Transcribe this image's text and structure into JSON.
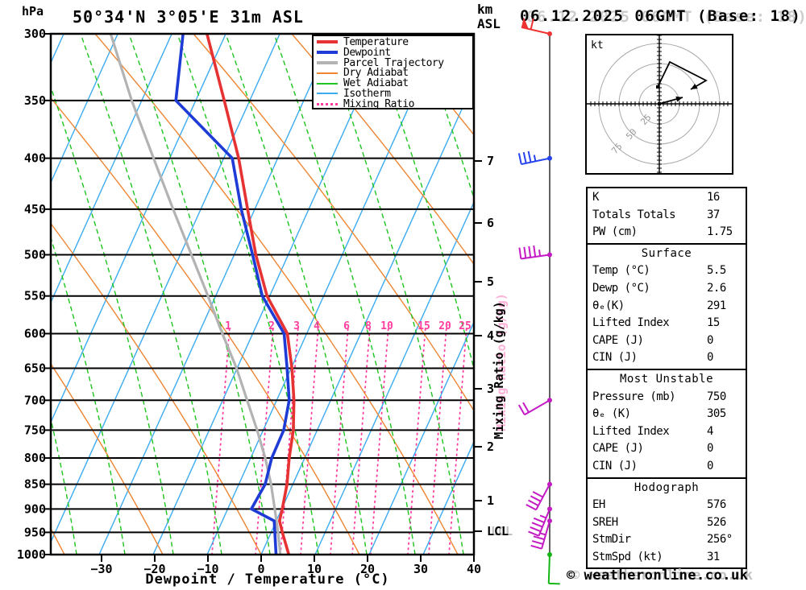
{
  "header": {
    "station_title": "50°34'N 3°05'E 31m ASL",
    "datetime": "06.12.2025 06GMT (Base: 18)",
    "pressure_unit": "hPa",
    "altitude_unit_line1": "km",
    "altitude_unit_line2": "ASL"
  },
  "legend": [
    {
      "label": "Temperature",
      "color": "#e63232",
      "style": "thick"
    },
    {
      "label": "Dewpoint",
      "color": "#1f3bd6",
      "style": "thick"
    },
    {
      "label": "Parcel Trajectory",
      "color": "#b3b3b3",
      "style": "thick"
    },
    {
      "label": "Dry Adiabat",
      "color": "#ef8532",
      "style": "thin"
    },
    {
      "label": "Wet Adiabat",
      "color": "#1fc420",
      "style": "thin"
    },
    {
      "label": "Isotherm",
      "color": "#3cabf0",
      "style": "thin"
    },
    {
      "label": "Mixing Ratio",
      "color": "#ff3d9e",
      "style": "dotted"
    }
  ],
  "axes": {
    "xlabel": "Dewpoint / Temperature (°C)",
    "temp_ticks": [
      -30,
      -20,
      -10,
      0,
      10,
      20,
      30,
      40
    ],
    "pressure_ticks": [
      300,
      350,
      400,
      450,
      500,
      550,
      600,
      650,
      700,
      750,
      800,
      850,
      900,
      950,
      1000
    ],
    "km_ticks": [
      7,
      6,
      5,
      4,
      3,
      2,
      1
    ],
    "lcl_label": "LCL",
    "mixing_axis_label": "Mixing Ratio (g/kg)",
    "mixing_ratio_values": [
      1,
      2,
      3,
      4,
      6,
      8,
      10,
      15,
      20,
      25
    ]
  },
  "chart_data": {
    "type": "line",
    "subtype": "skewt-log-p",
    "xlabel": "Dewpoint / Temperature (°C)",
    "xlim": [
      -40,
      40
    ],
    "pressure_lim": [
      1000,
      300
    ],
    "series": [
      {
        "name": "Temperature",
        "color": "#e63232",
        "points": [
          [
            300,
            -54.3
          ],
          [
            350,
            -45.4
          ],
          [
            400,
            -37.8
          ],
          [
            450,
            -31.8
          ],
          [
            500,
            -26.4
          ],
          [
            550,
            -20.8
          ],
          [
            600,
            -13.8
          ],
          [
            650,
            -10.0
          ],
          [
            700,
            -6.9
          ],
          [
            750,
            -4.5
          ],
          [
            800,
            -2.9
          ],
          [
            850,
            -1.1
          ],
          [
            900,
            0.1
          ],
          [
            925,
            0.6
          ],
          [
            950,
            2.1
          ],
          [
            1000,
            5.2
          ]
        ]
      },
      {
        "name": "Dewpoint",
        "color": "#1f3bd6",
        "points": [
          [
            300,
            -58.8
          ],
          [
            350,
            -54.5
          ],
          [
            400,
            -39.0
          ],
          [
            450,
            -33.0
          ],
          [
            500,
            -27.0
          ],
          [
            550,
            -21.7
          ],
          [
            600,
            -14.4
          ],
          [
            650,
            -10.9
          ],
          [
            700,
            -7.8
          ],
          [
            750,
            -6.3
          ],
          [
            800,
            -6.2
          ],
          [
            850,
            -5.2
          ],
          [
            900,
            -5.7
          ],
          [
            925,
            -0.4
          ],
          [
            950,
            0.7
          ],
          [
            1000,
            2.8
          ]
        ]
      },
      {
        "name": "Parcel Trajectory",
        "color": "#b3b3b3",
        "points": [
          [
            300,
            -72.4
          ],
          [
            350,
            -62.8
          ],
          [
            400,
            -53.8
          ],
          [
            450,
            -45.8
          ],
          [
            500,
            -38.5
          ],
          [
            550,
            -31.9
          ],
          [
            600,
            -26.0
          ],
          [
            650,
            -20.4
          ],
          [
            700,
            -15.7
          ],
          [
            750,
            -11.3
          ],
          [
            800,
            -7.4
          ],
          [
            850,
            -4.1
          ],
          [
            900,
            -1.3
          ],
          [
            950,
            1.3
          ],
          [
            1000,
            3.6
          ]
        ]
      }
    ]
  },
  "wind_barbs": [
    {
      "pressure": 300,
      "color": "#ee3333",
      "angle": 193,
      "flags": 1,
      "fulls": 1,
      "halfs": 0,
      "side": 1
    },
    {
      "pressure": 400,
      "color": "#2743ee",
      "angle": 168,
      "flags": 0,
      "fulls": 3,
      "halfs": 1,
      "side": 1
    },
    {
      "pressure": 500,
      "color": "#c41bc4",
      "angle": 172,
      "flags": 0,
      "fulls": 4,
      "halfs": 1,
      "side": 1
    },
    {
      "pressure": 700,
      "color": "#c41bc4",
      "angle": 150,
      "flags": 0,
      "fulls": 2,
      "halfs": 0,
      "side": 1
    },
    {
      "pressure": 850,
      "color": "#c41bc4",
      "angle": 118,
      "flags": 0,
      "fulls": 4,
      "halfs": 0,
      "side": 1
    },
    {
      "pressure": 900,
      "color": "#c41bc4",
      "angle": 112,
      "flags": 0,
      "fulls": 4,
      "halfs": 1,
      "side": 1
    },
    {
      "pressure": 925,
      "color": "#c41bc4",
      "angle": 106,
      "flags": 0,
      "fulls": 3,
      "halfs": 1,
      "side": 1
    },
    {
      "pressure": 1000,
      "color": "#14b514",
      "angle": 92,
      "flags": 0,
      "fulls": 1,
      "halfs": 0,
      "side": -1
    }
  ],
  "hodograph": {
    "unit_label": "kt",
    "rings": [
      25,
      50,
      75
    ],
    "trace": [
      [
        -2,
        -21
      ],
      [
        13,
        -52
      ],
      [
        58,
        -29
      ],
      [
        39,
        -18
      ]
    ],
    "storm_vector": [
      [
        0,
        0
      ],
      [
        29,
        -8
      ]
    ]
  },
  "tables": [
    {
      "title": "",
      "rows": [
        [
          "K",
          "16"
        ],
        [
          "Totals Totals",
          "37"
        ],
        [
          "PW (cm)",
          "1.75"
        ]
      ]
    },
    {
      "title": "Surface",
      "rows": [
        [
          "Temp (°C)",
          "5.5"
        ],
        [
          "Dewp (°C)",
          "2.6"
        ],
        [
          "θₑ(K)",
          "291"
        ],
        [
          "Lifted Index",
          "15"
        ],
        [
          "CAPE (J)",
          "0"
        ],
        [
          "CIN (J)",
          "0"
        ]
      ]
    },
    {
      "title": "Most Unstable",
      "rows": [
        [
          "Pressure (mb)",
          "750"
        ],
        [
          "θₑ (K)",
          "305"
        ],
        [
          "Lifted Index",
          "4"
        ],
        [
          "CAPE (J)",
          "0"
        ],
        [
          "CIN (J)",
          "0"
        ]
      ]
    },
    {
      "title": "Hodograph",
      "rows": [
        [
          "EH",
          "576"
        ],
        [
          "SREH",
          "526"
        ],
        [
          "StmDir",
          "256°"
        ],
        [
          "StmSpd (kt)",
          "31"
        ]
      ]
    }
  ],
  "watermark": "© weatheronline.co.uk"
}
